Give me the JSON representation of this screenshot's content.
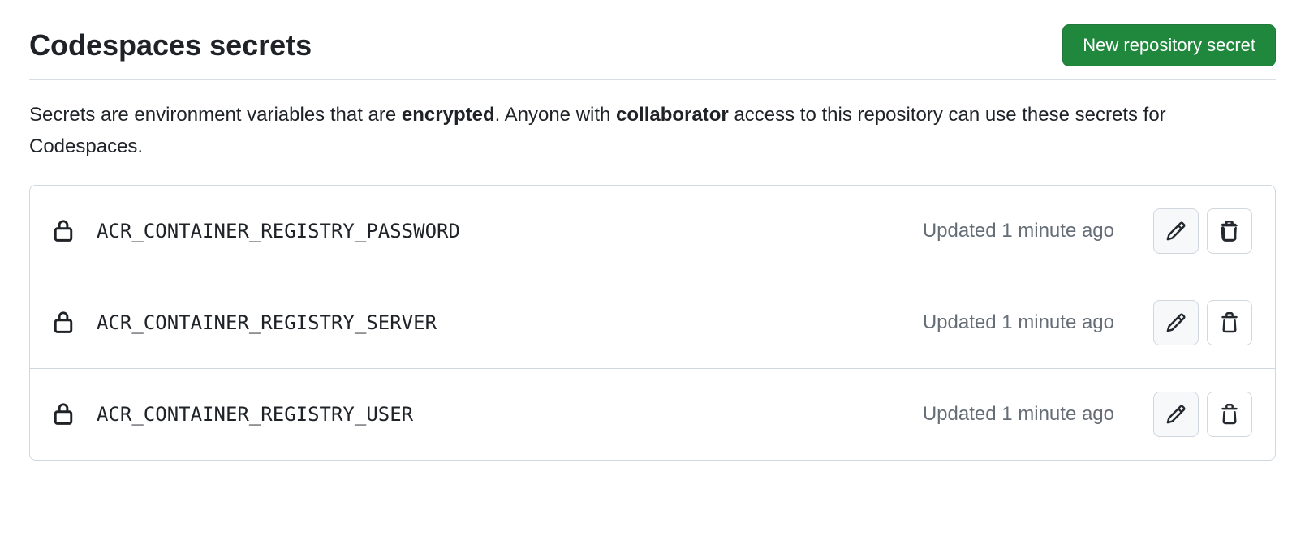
{
  "header": {
    "title": "Codespaces secrets",
    "new_button_label": "New repository secret"
  },
  "description": {
    "prefix": "Secrets are environment variables that are ",
    "encrypted": "encrypted",
    "mid": ". Anyone with ",
    "collaborator": "collaborator",
    "suffix": " access to this repository can use these secrets for Codespaces."
  },
  "secrets": [
    {
      "name": "ACR_CONTAINER_REGISTRY_PASSWORD",
      "updated": "Updated 1 minute ago"
    },
    {
      "name": "ACR_CONTAINER_REGISTRY_SERVER",
      "updated": "Updated 1 minute ago"
    },
    {
      "name": "ACR_CONTAINER_REGISTRY_USER",
      "updated": "Updated 1 minute ago"
    }
  ]
}
